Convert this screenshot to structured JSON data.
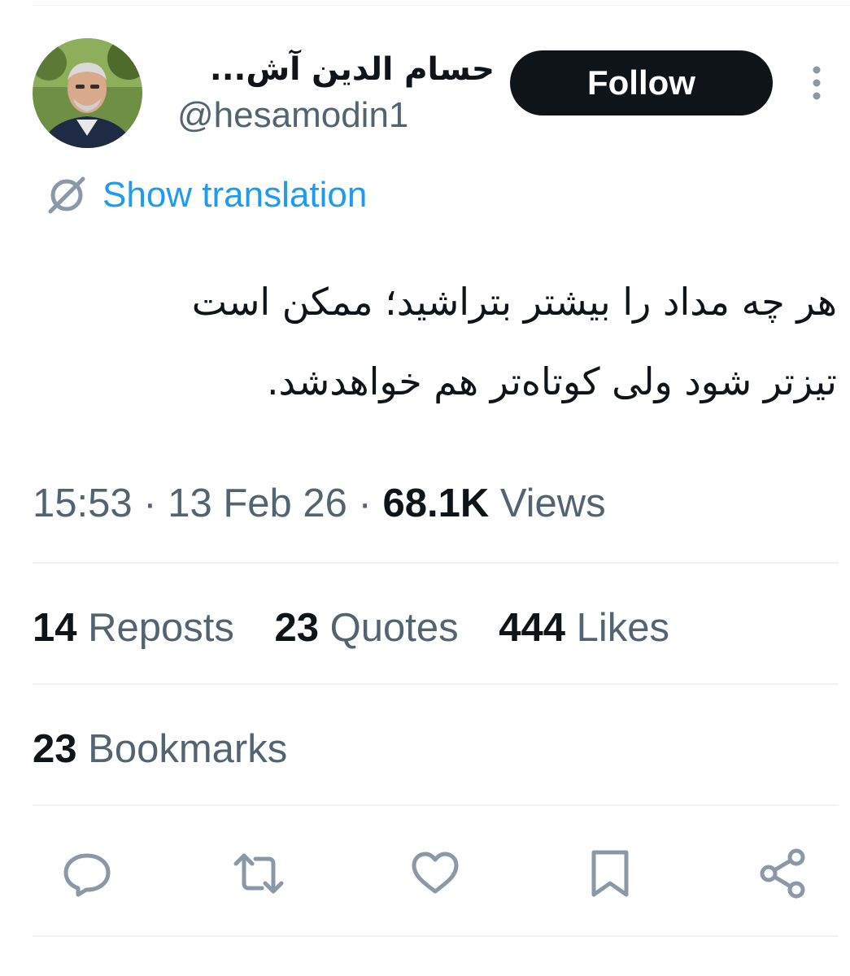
{
  "author": {
    "display_name": "حسام الدین آش...",
    "handle": "@hesamodin1"
  },
  "follow_button": {
    "label": "Follow"
  },
  "more_button": {
    "icon": "more-vertical-icon"
  },
  "translation": {
    "icon": "translate-globe-icon",
    "label": "Show translation"
  },
  "tweet": {
    "text_line1": "هر چه مداد را بیشتر بتراشید؛ ممکن است",
    "text_line2": "تیزتر شود ولی کوتاه‌تر هم خواهدشد."
  },
  "meta": {
    "time": "15:53",
    "separator": "·",
    "date": "13 Feb 26",
    "views_count": "68.1K",
    "views_label": "Views"
  },
  "stats": {
    "reposts_count": "14",
    "reposts_label": "Reposts",
    "quotes_count": "23",
    "quotes_label": "Quotes",
    "likes_count": "444",
    "likes_label": "Likes",
    "bookmarks_count": "23",
    "bookmarks_label": "Bookmarks"
  },
  "actions": [
    {
      "icon": "reply-icon"
    },
    {
      "icon": "repost-icon"
    },
    {
      "icon": "like-icon"
    },
    {
      "icon": "bookmark-icon"
    },
    {
      "icon": "share-icon"
    }
  ],
  "colors": {
    "text_primary": "#0f1419",
    "text_secondary": "#536471",
    "link": "#1d9bf0",
    "button_bg": "#0f1419",
    "divider": "#eff3f4",
    "icon_gray": "#8b98a5"
  }
}
